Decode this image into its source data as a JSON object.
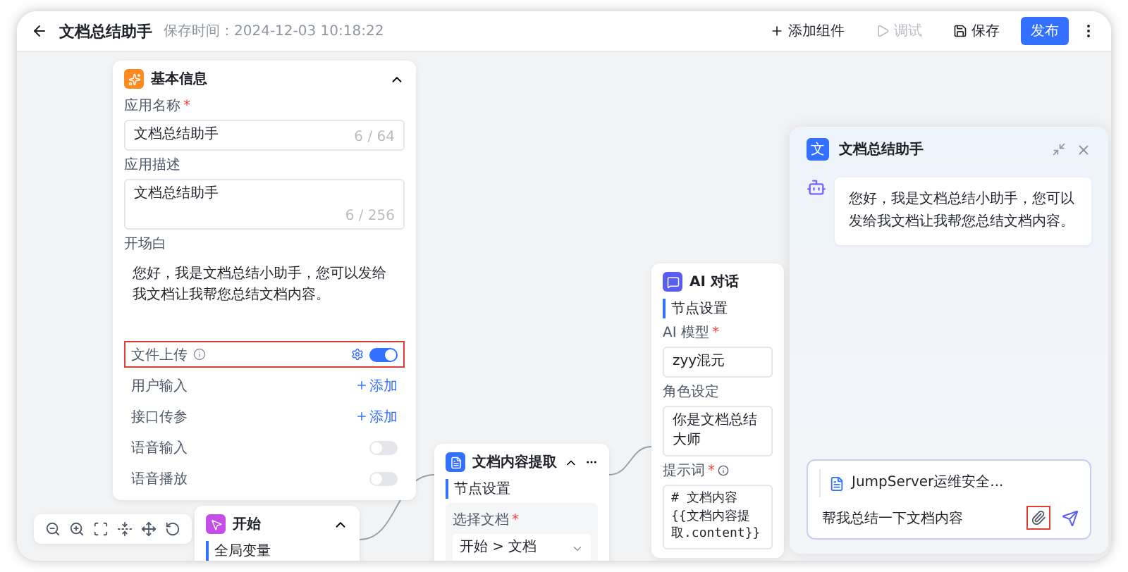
{
  "header": {
    "title": "文档总结助手",
    "save_time": "保存时间：2024-12-03 10:18:22",
    "actions": [
      {
        "kind": "add",
        "label": "添加组件",
        "disabled": false
      },
      {
        "kind": "debug",
        "label": "调试",
        "disabled": true
      },
      {
        "kind": "save",
        "label": "保存",
        "disabled": false
      },
      {
        "kind": "publish",
        "label": "发布",
        "disabled": false
      }
    ]
  },
  "base_info": {
    "title": "基本信息",
    "expanded": true,
    "fields": [
      {
        "kind": "input",
        "label": "应用名称",
        "required_mark": "*",
        "value": "文档总结助手",
        "counter": "6 / 64"
      },
      {
        "kind": "textarea",
        "label": "应用描述",
        "value": "文档总结助手",
        "counter": "6 / 256"
      },
      {
        "kind": "opening",
        "label": "开场白",
        "value": "您好，我是文档总结小助手，您可以发给我文档让我帮您总结文档内容。"
      }
    ],
    "settings": [
      {
        "kind": "toggle",
        "label": "文件上传",
        "info": true,
        "gear": true,
        "on": true,
        "highlighted": true
      },
      {
        "kind": "add",
        "label": "用户输入",
        "action": "添加",
        "highlighted": false
      },
      {
        "kind": "add",
        "label": "接口传参",
        "action": "添加",
        "highlighted": false
      },
      {
        "kind": "toggle",
        "label": "语音输入",
        "on": false,
        "highlighted": false
      },
      {
        "kind": "toggle",
        "label": "语音播放",
        "on": false,
        "highlighted": false
      }
    ]
  },
  "start_node": {
    "title": "开始",
    "expanded": true,
    "section": "全局变量"
  },
  "extract_node": {
    "title": "文档内容提取",
    "expanded": true,
    "section": "节点设置",
    "field": {
      "label": "选择文档",
      "required_mark": "*",
      "value": "开始 > 文档"
    }
  },
  "ai_node": {
    "title": "AI 对话",
    "section": "节点设置",
    "fields": [
      {
        "kind": "input",
        "label": "AI 模型",
        "required_mark": "*",
        "value": "zyy混元"
      },
      {
        "kind": "textarea",
        "label": "角色设定",
        "value": "你是文档总结大师"
      },
      {
        "kind": "code",
        "label": "提示词",
        "required_mark": "*",
        "info": true,
        "lines": [
          "# 文档内容",
          "{{文档内容提取.content}}"
        ]
      }
    ]
  },
  "chat": {
    "avatar_text": "文",
    "title": "文档总结助手",
    "messages": [
      {
        "text": "您好，我是文档总结小助手，您可以发给我文档让我帮您总结文档内容。"
      }
    ],
    "input": {
      "attachment": "JumpServer运维安全...",
      "value": "帮我总结一下文档内容",
      "attach_highlighted": true
    }
  }
}
